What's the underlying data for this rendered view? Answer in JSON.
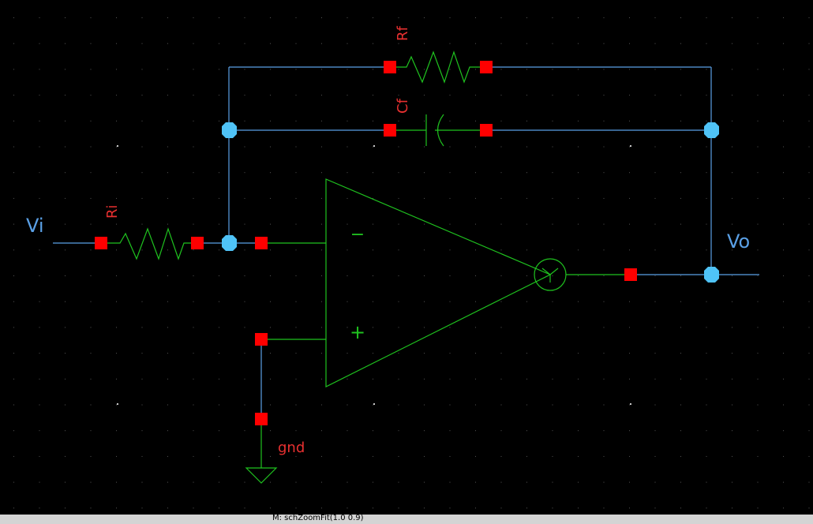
{
  "labels": {
    "vi": "Vi",
    "vo": "Vo",
    "ri": "Ri",
    "rf": "Rf",
    "cf": "Cf",
    "gnd": "gnd",
    "minus": "−",
    "plus": "+"
  },
  "status": {
    "text": "M: schZoomFit(1.0 0.9)"
  },
  "colors": {
    "background": "#000000",
    "wire": "#5aa0e6",
    "component": "#1fc21f",
    "pin": "#ff0000",
    "junction": "#4fc3f7",
    "instance_label": "#e83030",
    "net_label": "#5aa0e6",
    "grid_dot": "#c8c8c8",
    "statusbar": "#d4d4d4"
  }
}
